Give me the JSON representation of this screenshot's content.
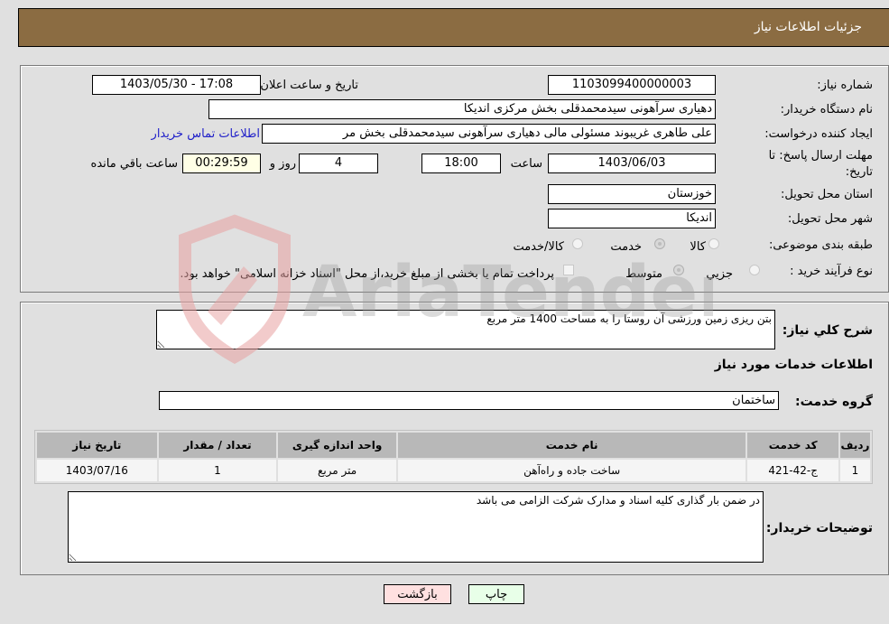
{
  "header": {
    "title": "جزئیات اطلاعات نیاز"
  },
  "details": {
    "need_number": {
      "label": "شماره نیاز:",
      "value": "1103099400000003"
    },
    "announce_datetime": {
      "label": "تاریخ و ساعت اعلان عمومي:",
      "value": "1403/05/30 - 17:08"
    },
    "buyer_org": {
      "label": "نام دستگاه خریدار:",
      "value": "دهیاری سرآهونی سیدمحمدقلی بخش مرکزی اندیکا"
    },
    "requester": {
      "label": "ایجاد کننده درخواست:",
      "value": "علی طاهری غریبوند مسئولی مالی  دهیاری سرآهونی سیدمحمدقلی بخش مر",
      "contact_link": "اطلاعات تماس خریدار"
    },
    "deadline": {
      "label": "مهلت ارسال پاسخ: تا تاریخ:",
      "date": "1403/06/03",
      "time_label": "ساعت",
      "time": "18:00",
      "days": "4",
      "days_label": "روز و",
      "remaining": "00:29:59",
      "remaining_label": "ساعت باقي مانده"
    },
    "province": {
      "label": "استان محل تحویل:",
      "value": "خوزستان"
    },
    "city": {
      "label": "شهر محل تحویل:",
      "value": "اندیکا"
    },
    "category": {
      "label": "طبقه بندی موضوعی:",
      "options": [
        {
          "label": "کالا",
          "selected": false
        },
        {
          "label": "خدمت",
          "selected": true
        },
        {
          "label": "کالا/خدمت",
          "selected": false
        }
      ]
    },
    "purchase_type": {
      "label": "نوع فرآیند خرید :",
      "options": [
        {
          "label": "جزيي",
          "selected": false
        },
        {
          "label": "متوسط",
          "selected": true
        }
      ],
      "treasury_checkbox": {
        "label": "پرداخت تمام یا بخشی از مبلغ خرید،از محل \"اسناد خزانه اسلامی\" خواهد بود.",
        "checked": false
      }
    }
  },
  "description": {
    "label": "شرح کلي نیاز:",
    "value": "بتن ریزی زمین ورزشی آن روستا را به مساحت 1400 متر مربع"
  },
  "services": {
    "section_title": "اطلاعات خدمات مورد نیاز",
    "group_label": "گروه خدمت:",
    "group_value": "ساختمان",
    "table": {
      "headers": [
        "ردیف",
        "کد خدمت",
        "نام خدمت",
        "واحد اندازه گیری",
        "تعداد / مقدار",
        "تاریخ نیاز"
      ],
      "rows": [
        [
          "1",
          "ج-42-421",
          "ساخت جاده و راه‌آهن",
          "متر مربع",
          "1",
          "1403/07/16"
        ]
      ]
    }
  },
  "buyer_notes": {
    "label": "توضیحات خریدار:",
    "value": "در ضمن بار گذاری کلیه اسناد و مدارک شرکت الزامی می باشد"
  },
  "buttons": {
    "print": "چاپ",
    "back": "بازگشت"
  },
  "watermark": {
    "text": "AriaTender.neT"
  },
  "colors": {
    "header_bg": "#8b6c42",
    "link": "#2121c9",
    "remaining_bg": "#ffffe6",
    "back_btn": "#ffe0e0",
    "print_btn": "#e8ffe8"
  }
}
